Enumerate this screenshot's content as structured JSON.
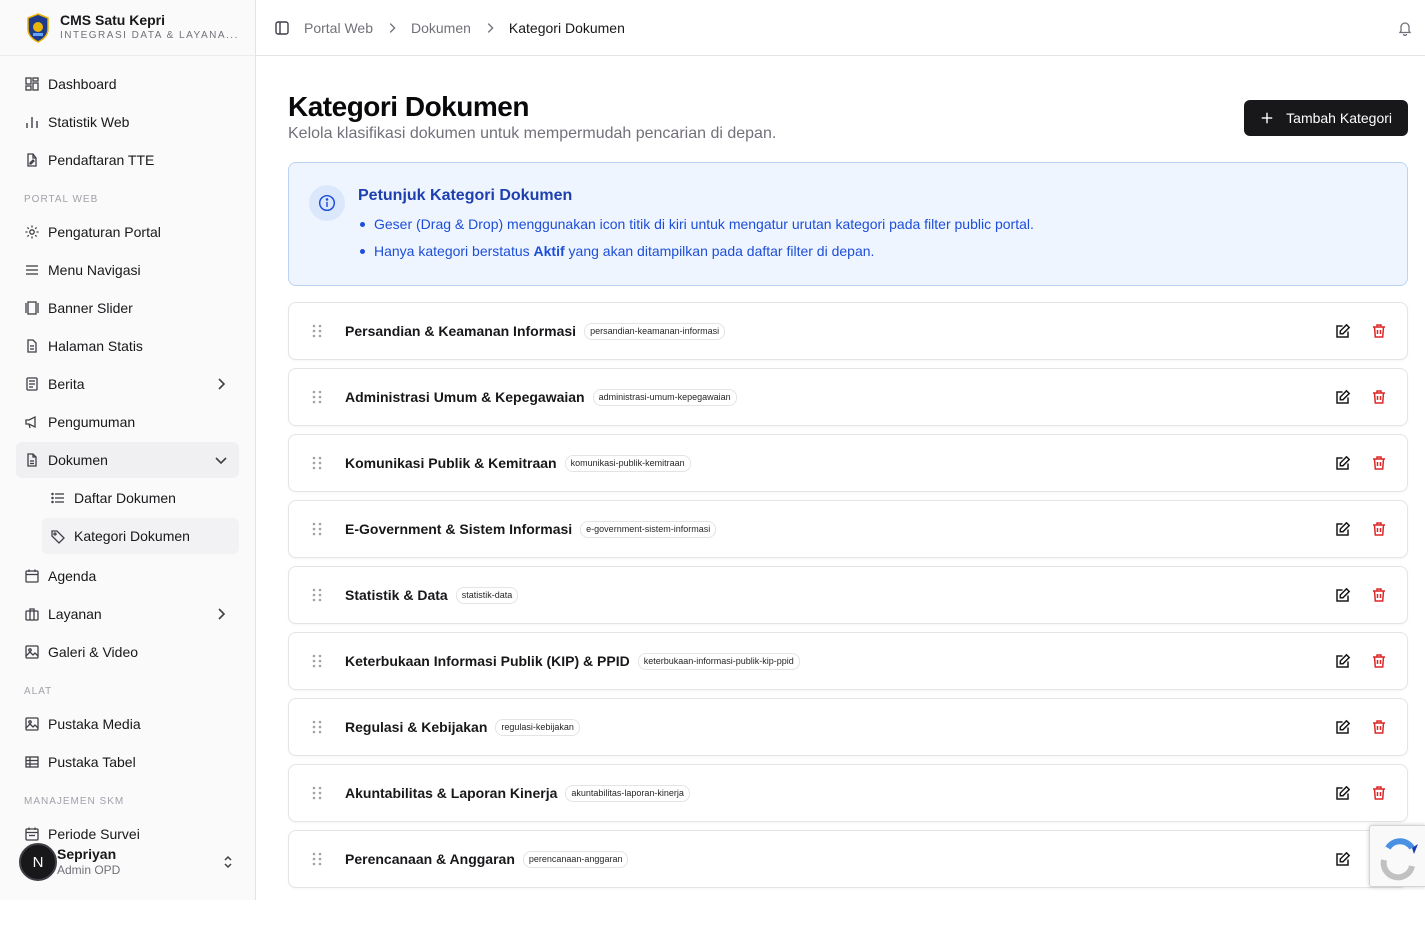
{
  "brand": {
    "title": "CMS Satu Kepri",
    "subtitle": "INTEGRASI DATA & LAYANA..."
  },
  "sidebar": {
    "top_items": [
      {
        "label": "Dashboard",
        "icon": "dashboard-icon"
      },
      {
        "label": "Statistik Web",
        "icon": "bar-chart-icon"
      },
      {
        "label": "Pendaftaran TTE",
        "icon": "file-signature-icon"
      }
    ],
    "section_portal": "PORTAL WEB",
    "portal_items": [
      {
        "label": "Pengaturan Portal",
        "icon": "gear-icon"
      },
      {
        "label": "Menu Navigasi",
        "icon": "menu-icon"
      },
      {
        "label": "Banner Slider",
        "icon": "slider-icon"
      },
      {
        "label": "Halaman Statis",
        "icon": "page-icon"
      },
      {
        "label": "Berita",
        "icon": "newspaper-icon"
      },
      {
        "label": "Pengumuman",
        "icon": "megaphone-icon"
      },
      {
        "label": "Dokumen",
        "icon": "document-icon"
      }
    ],
    "dokumen_sub": [
      {
        "label": "Daftar Dokumen",
        "icon": "list-icon"
      },
      {
        "label": "Kategori Dokumen",
        "icon": "tag-icon"
      }
    ],
    "portal_items_2": [
      {
        "label": "Agenda",
        "icon": "calendar-icon"
      },
      {
        "label": "Layanan",
        "icon": "briefcase-icon"
      },
      {
        "label": "Galeri & Video",
        "icon": "image-icon"
      }
    ],
    "section_alat": "ALAT",
    "alat_items": [
      {
        "label": "Pustaka Media",
        "icon": "image-icon"
      },
      {
        "label": "Pustaka Tabel",
        "icon": "table-icon"
      }
    ],
    "section_skm": "MANAJEMEN SKM",
    "skm_items": [
      {
        "label": "Periode Survei",
        "icon": "calendar-icon"
      }
    ],
    "user": {
      "initial": "N",
      "name": "Sepriyan",
      "role": "Admin OPD"
    }
  },
  "breadcrumb": [
    "Portal Web",
    "Dokumen",
    "Kategori Dokumen"
  ],
  "page": {
    "title": "Kategori Dokumen",
    "subtitle": "Kelola klasifikasi dokumen untuk mempermudah pencarian di depan.",
    "add_button": "Tambah Kategori"
  },
  "info": {
    "title": "Petunjuk Kategori Dokumen",
    "line1": "Geser (Drag & Drop) menggunakan icon titik di kiri untuk mengatur urutan kategori pada filter public portal.",
    "line2_pre": "Hanya kategori berstatus ",
    "line2_bold": "Aktif",
    "line2_post": " yang akan ditampilkan pada daftar filter di depan."
  },
  "categories": [
    {
      "name": "Persandian & Keamanan Informasi",
      "slug": "persandian-keamanan-informasi"
    },
    {
      "name": "Administrasi Umum & Kepegawaian",
      "slug": "administrasi-umum-kepegawaian"
    },
    {
      "name": "Komunikasi Publik & Kemitraan",
      "slug": "komunikasi-publik-kemitraan"
    },
    {
      "name": "E-Government & Sistem Informasi",
      "slug": "e-government-sistem-informasi"
    },
    {
      "name": "Statistik & Data",
      "slug": "statistik-data"
    },
    {
      "name": "Keterbukaan Informasi Publik (KIP) & PPID",
      "slug": "keterbukaan-informasi-publik-kip-ppid"
    },
    {
      "name": "Regulasi & Kebijakan",
      "slug": "regulasi-kebijakan"
    },
    {
      "name": "Akuntabilitas & Laporan Kinerja",
      "slug": "akuntabilitas-laporan-kinerja"
    },
    {
      "name": "Perencanaan & Anggaran",
      "slug": "perencanaan-anggaran"
    }
  ]
}
